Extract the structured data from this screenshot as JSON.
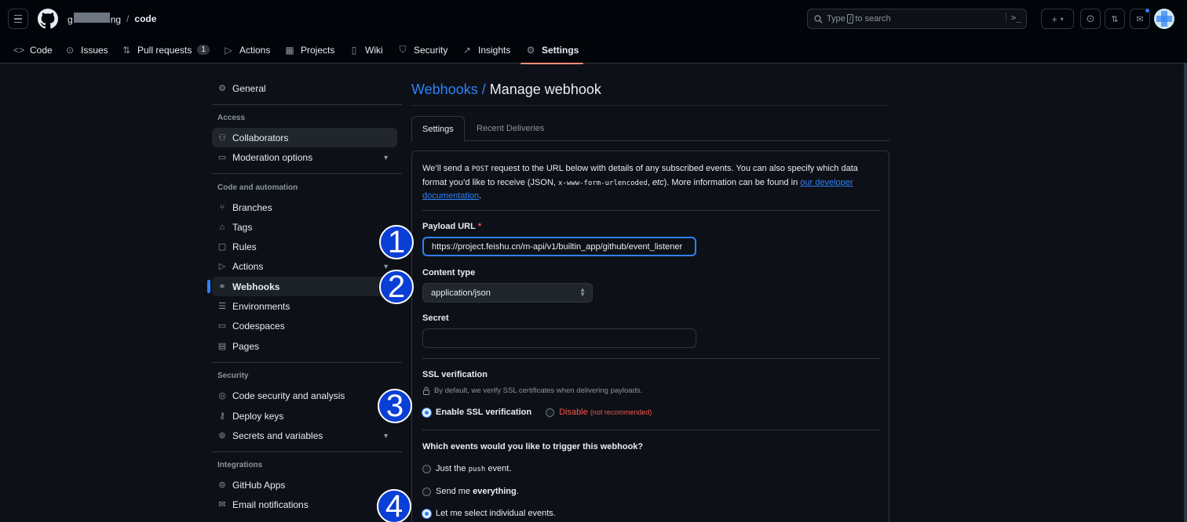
{
  "header": {
    "repo_owner_start": "g",
    "repo_owner_end": "ng",
    "separator": "/",
    "repo_name": "code",
    "search_prefix": "Type",
    "search_key": "/",
    "search_suffix": "to search",
    "command_palette": ">_",
    "create_label": "+",
    "dropdown_caret": "▾"
  },
  "repo_nav": [
    {
      "label": "Code",
      "icon": "code-icon",
      "glyph": "<>"
    },
    {
      "label": "Issues",
      "icon": "issue-icon",
      "glyph": "⊙"
    },
    {
      "label": "Pull requests",
      "icon": "pull-request-icon",
      "glyph": "⇅",
      "count": "1"
    },
    {
      "label": "Actions",
      "icon": "play-icon",
      "glyph": "▷"
    },
    {
      "label": "Projects",
      "icon": "table-icon",
      "glyph": "▦"
    },
    {
      "label": "Wiki",
      "icon": "book-icon",
      "glyph": "▯"
    },
    {
      "label": "Security",
      "icon": "shield-icon",
      "glyph": "⛉"
    },
    {
      "label": "Insights",
      "icon": "graph-icon",
      "glyph": "↗"
    },
    {
      "label": "Settings",
      "icon": "gear-icon",
      "glyph": "⚙",
      "active": true
    }
  ],
  "sidebar": {
    "general": "General",
    "access_heading": "Access",
    "collaborators": "Collaborators",
    "moderation": "Moderation options",
    "code_heading": "Code and automation",
    "branches": "Branches",
    "tags": "Tags",
    "rules": "Rules",
    "actions": "Actions",
    "webhooks": "Webhooks",
    "environments": "Environments",
    "codespaces": "Codespaces",
    "pages": "Pages",
    "security_heading": "Security",
    "code_security": "Code security and analysis",
    "deploy_keys": "Deploy keys",
    "secrets": "Secrets and variables",
    "integrations_heading": "Integrations",
    "github_apps": "GitHub Apps",
    "email_notifications": "Email notifications"
  },
  "main": {
    "title_link": "Webhooks /",
    "title_rest": "Manage webhook",
    "tab_settings": "Settings",
    "tab_deliveries": "Recent Deliveries",
    "intro_1": "We’ll send a",
    "intro_post": "POST",
    "intro_2": "request to the URL below with details of any subscribed events. You can also specify which data format you’d like to receive (JSON,",
    "intro_form": "x-www-form-urlencoded",
    "intro_3": ",",
    "intro_etc": "etc",
    "intro_4": "). More information can be found in",
    "intro_link": "our developer documentation",
    "intro_5": ".",
    "payload_label": "Payload URL",
    "required_mark": "*",
    "payload_value": "https://project.feishu.cn/m-api/v1/builtin_app/github/event_listener",
    "content_type_label": "Content type",
    "content_type_value": "application/json",
    "secret_label": "Secret",
    "secret_value": "",
    "ssl_label": "SSL verification",
    "ssl_note": "By default, we verify SSL certificates when delivering payloads.",
    "ssl_enable": "Enable SSL verification",
    "ssl_disable": "Disable",
    "ssl_disable_note": "(not recommended)",
    "events_label": "Which events would you like to trigger this webhook?",
    "ev_push_1": "Just the",
    "ev_push_code": "push",
    "ev_push_2": "event.",
    "ev_all_1": "Send me",
    "ev_all_b": "everything",
    "ev_all_2": ".",
    "ev_select": "Let me select individual events."
  },
  "badges": [
    "1",
    "2",
    "3",
    "4"
  ],
  "colors": {
    "accent": "#2f81f7",
    "active_tab_underline": "#fd8c73",
    "danger": "#f85149",
    "badge": "#0a3fd6"
  }
}
